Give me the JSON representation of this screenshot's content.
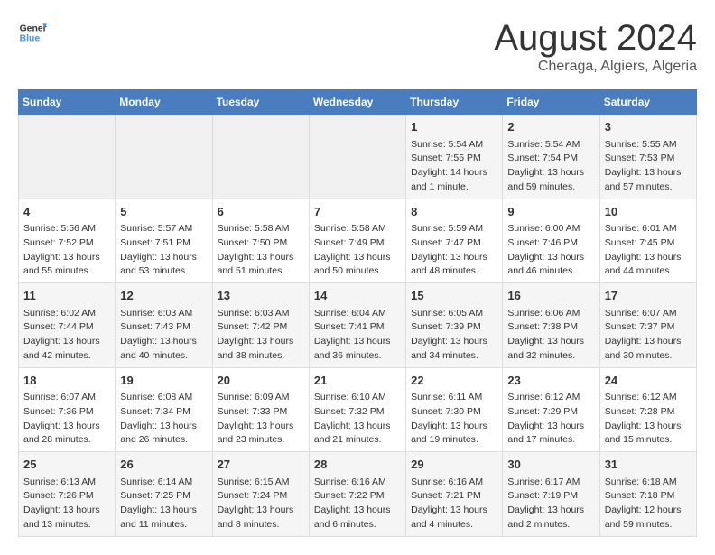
{
  "header": {
    "logo_general": "General",
    "logo_blue": "Blue",
    "title": "August 2024",
    "subtitle": "Cheraga, Algiers, Algeria"
  },
  "weekdays": [
    "Sunday",
    "Monday",
    "Tuesday",
    "Wednesday",
    "Thursday",
    "Friday",
    "Saturday"
  ],
  "weeks": [
    [
      {
        "day": "",
        "content": ""
      },
      {
        "day": "",
        "content": ""
      },
      {
        "day": "",
        "content": ""
      },
      {
        "day": "",
        "content": ""
      },
      {
        "day": "1",
        "content": "Sunrise: 5:54 AM\nSunset: 7:55 PM\nDaylight: 14 hours\nand 1 minute."
      },
      {
        "day": "2",
        "content": "Sunrise: 5:54 AM\nSunset: 7:54 PM\nDaylight: 13 hours\nand 59 minutes."
      },
      {
        "day": "3",
        "content": "Sunrise: 5:55 AM\nSunset: 7:53 PM\nDaylight: 13 hours\nand 57 minutes."
      }
    ],
    [
      {
        "day": "4",
        "content": "Sunrise: 5:56 AM\nSunset: 7:52 PM\nDaylight: 13 hours\nand 55 minutes."
      },
      {
        "day": "5",
        "content": "Sunrise: 5:57 AM\nSunset: 7:51 PM\nDaylight: 13 hours\nand 53 minutes."
      },
      {
        "day": "6",
        "content": "Sunrise: 5:58 AM\nSunset: 7:50 PM\nDaylight: 13 hours\nand 51 minutes."
      },
      {
        "day": "7",
        "content": "Sunrise: 5:58 AM\nSunset: 7:49 PM\nDaylight: 13 hours\nand 50 minutes."
      },
      {
        "day": "8",
        "content": "Sunrise: 5:59 AM\nSunset: 7:47 PM\nDaylight: 13 hours\nand 48 minutes."
      },
      {
        "day": "9",
        "content": "Sunrise: 6:00 AM\nSunset: 7:46 PM\nDaylight: 13 hours\nand 46 minutes."
      },
      {
        "day": "10",
        "content": "Sunrise: 6:01 AM\nSunset: 7:45 PM\nDaylight: 13 hours\nand 44 minutes."
      }
    ],
    [
      {
        "day": "11",
        "content": "Sunrise: 6:02 AM\nSunset: 7:44 PM\nDaylight: 13 hours\nand 42 minutes."
      },
      {
        "day": "12",
        "content": "Sunrise: 6:03 AM\nSunset: 7:43 PM\nDaylight: 13 hours\nand 40 minutes."
      },
      {
        "day": "13",
        "content": "Sunrise: 6:03 AM\nSunset: 7:42 PM\nDaylight: 13 hours\nand 38 minutes."
      },
      {
        "day": "14",
        "content": "Sunrise: 6:04 AM\nSunset: 7:41 PM\nDaylight: 13 hours\nand 36 minutes."
      },
      {
        "day": "15",
        "content": "Sunrise: 6:05 AM\nSunset: 7:39 PM\nDaylight: 13 hours\nand 34 minutes."
      },
      {
        "day": "16",
        "content": "Sunrise: 6:06 AM\nSunset: 7:38 PM\nDaylight: 13 hours\nand 32 minutes."
      },
      {
        "day": "17",
        "content": "Sunrise: 6:07 AM\nSunset: 7:37 PM\nDaylight: 13 hours\nand 30 minutes."
      }
    ],
    [
      {
        "day": "18",
        "content": "Sunrise: 6:07 AM\nSunset: 7:36 PM\nDaylight: 13 hours\nand 28 minutes."
      },
      {
        "day": "19",
        "content": "Sunrise: 6:08 AM\nSunset: 7:34 PM\nDaylight: 13 hours\nand 26 minutes."
      },
      {
        "day": "20",
        "content": "Sunrise: 6:09 AM\nSunset: 7:33 PM\nDaylight: 13 hours\nand 23 minutes."
      },
      {
        "day": "21",
        "content": "Sunrise: 6:10 AM\nSunset: 7:32 PM\nDaylight: 13 hours\nand 21 minutes."
      },
      {
        "day": "22",
        "content": "Sunrise: 6:11 AM\nSunset: 7:30 PM\nDaylight: 13 hours\nand 19 minutes."
      },
      {
        "day": "23",
        "content": "Sunrise: 6:12 AM\nSunset: 7:29 PM\nDaylight: 13 hours\nand 17 minutes."
      },
      {
        "day": "24",
        "content": "Sunrise: 6:12 AM\nSunset: 7:28 PM\nDaylight: 13 hours\nand 15 minutes."
      }
    ],
    [
      {
        "day": "25",
        "content": "Sunrise: 6:13 AM\nSunset: 7:26 PM\nDaylight: 13 hours\nand 13 minutes."
      },
      {
        "day": "26",
        "content": "Sunrise: 6:14 AM\nSunset: 7:25 PM\nDaylight: 13 hours\nand 11 minutes."
      },
      {
        "day": "27",
        "content": "Sunrise: 6:15 AM\nSunset: 7:24 PM\nDaylight: 13 hours\nand 8 minutes."
      },
      {
        "day": "28",
        "content": "Sunrise: 6:16 AM\nSunset: 7:22 PM\nDaylight: 13 hours\nand 6 minutes."
      },
      {
        "day": "29",
        "content": "Sunrise: 6:16 AM\nSunset: 7:21 PM\nDaylight: 13 hours\nand 4 minutes."
      },
      {
        "day": "30",
        "content": "Sunrise: 6:17 AM\nSunset: 7:19 PM\nDaylight: 13 hours\nand 2 minutes."
      },
      {
        "day": "31",
        "content": "Sunrise: 6:18 AM\nSunset: 7:18 PM\nDaylight: 12 hours\nand 59 minutes."
      }
    ]
  ]
}
